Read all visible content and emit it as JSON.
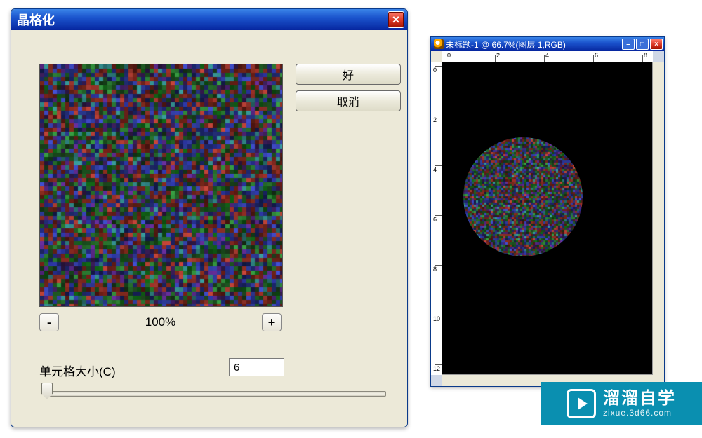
{
  "dialog": {
    "title": "晶格化",
    "close_glyph": "×",
    "ok_label": "好",
    "cancel_label": "取消",
    "zoom_minus": "-",
    "zoom_plus": "+",
    "zoom_label": "100%",
    "cell_size_label": "单元格大小(C)",
    "cell_size_value": "6"
  },
  "doc": {
    "title": "未标题-1 @ 66.7%(图层 1,RGB)",
    "top_ruler_labels": [
      "0",
      "2",
      "4",
      "6",
      "8"
    ],
    "left_ruler_labels": [
      "0",
      "2",
      "4",
      "6",
      "8",
      "10",
      "12"
    ],
    "min_glyph": "–",
    "max_glyph": "□",
    "close_glyph": "×"
  },
  "watermark": {
    "main": "溜溜自学",
    "sub": "zixue.3d66.com"
  }
}
